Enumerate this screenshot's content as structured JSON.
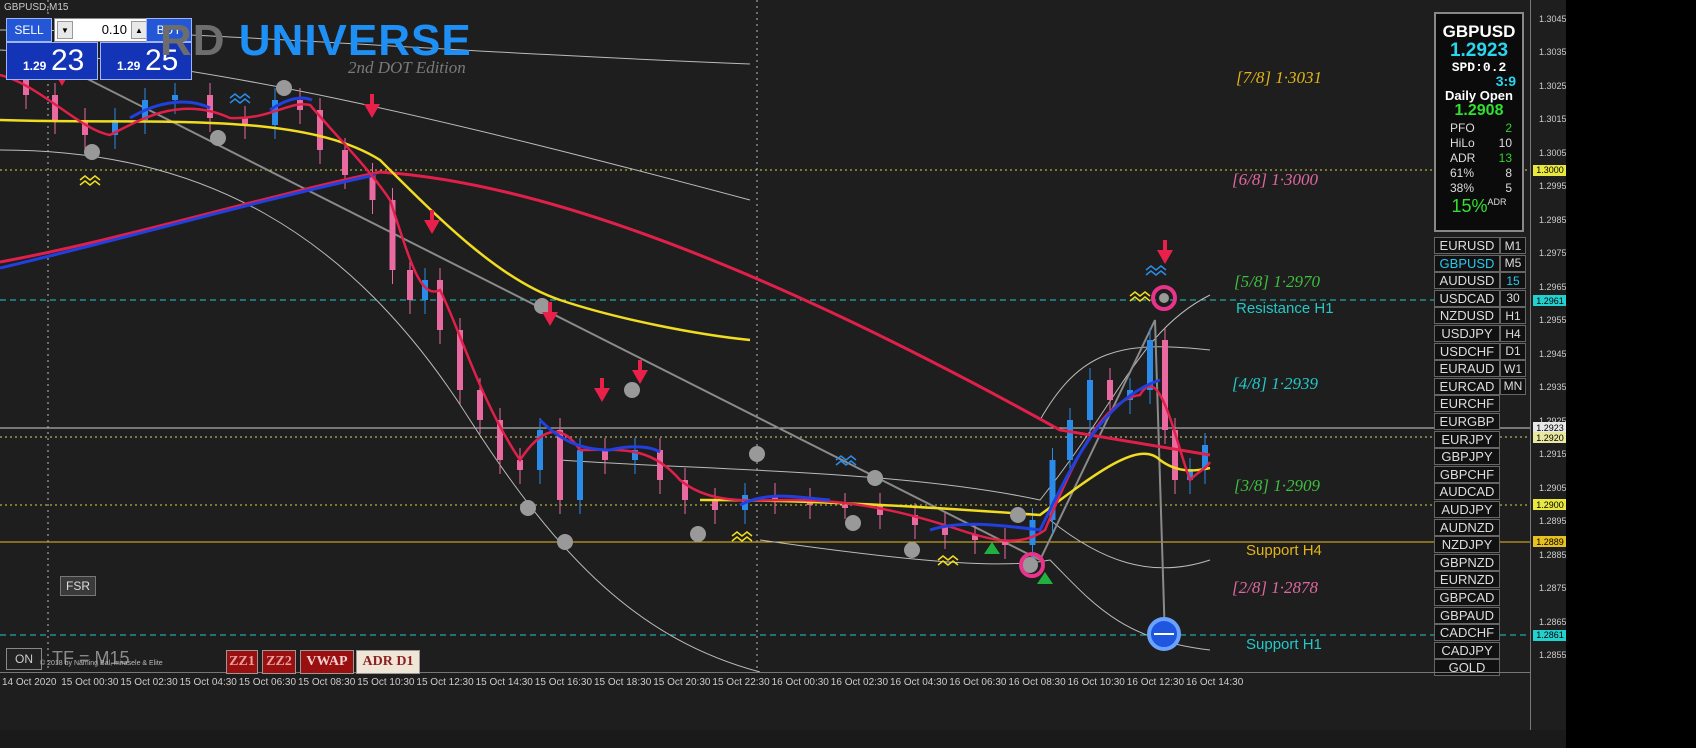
{
  "window": {
    "title": "GBPUSD,M15"
  },
  "trade_panel": {
    "sell_label": "SELL",
    "buy_label": "BUY",
    "lot": "0.10",
    "sell_small": "1.29",
    "sell_big": "23",
    "buy_small": "1.29",
    "buy_big": "25"
  },
  "logo": {
    "part1": "RD ",
    "part2": "UNIVERSE",
    "subtitle": "2nd DOT Edition"
  },
  "levels": [
    {
      "text": "[7/8]  1·3031",
      "color": "#e3b416"
    },
    {
      "text": "[6/8]  1·3000",
      "color": "#e0679f"
    },
    {
      "text": "[5/8]  1·2970",
      "color": "#3fbe3f"
    },
    {
      "text": "[4/8]  1·2939",
      "color": "#23c8c8"
    },
    {
      "text": "[3/8]  1·2909",
      "color": "#3fbe3f"
    },
    {
      "text": "[2/8]  1·2878",
      "color": "#e0679f"
    }
  ],
  "labels": {
    "resistance_h1": "Resistance H1",
    "support_h4": "Support H4",
    "support_h1": "Support H1"
  },
  "info": {
    "symbol": "GBPUSD",
    "price": "1.2923",
    "spread": "SPD:0.2",
    "ratio": "3:9",
    "daily_open_label": "Daily Open",
    "daily_open": "1.2908",
    "rows": [
      {
        "k": "PFO",
        "v": "2",
        "c": "#2fd42f"
      },
      {
        "k": "HiLo",
        "v": "10",
        "c": "#ddd"
      },
      {
        "k": "ADR",
        "v": "13",
        "c": "#2fd42f"
      },
      {
        "k": "61%",
        "v": "8",
        "c": "#ddd"
      },
      {
        "k": "38%",
        "v": "5",
        "c": "#ddd"
      }
    ],
    "pct": "15%",
    "pct_suffix": "ADR"
  },
  "symbols": [
    "EURUSD",
    "GBPUSD",
    "AUDUSD",
    "USDCAD",
    "NZDUSD",
    "USDJPY",
    "USDCHF",
    "EURAUD",
    "EURCAD",
    "EURCHF",
    "EURGBP",
    "EURJPY",
    "GBPJPY",
    "GBPCHF",
    "AUDCAD",
    "AUDJPY",
    "AUDNZD",
    "NZDJPY",
    "GBPNZD",
    "EURNZD",
    "GBPCAD",
    "GBPAUD",
    "CADCHF",
    "CADJPY",
    "GOLD"
  ],
  "timeframes": [
    "M1",
    "M5",
    "15",
    "30",
    "H1",
    "H4",
    "D1",
    "W1",
    "MN"
  ],
  "price_axis": {
    "ticks": [
      "1.3045",
      "1.3035",
      "1.3025",
      "1.3015",
      "1.3005",
      "1.2995",
      "1.2985",
      "1.2975",
      "1.2965",
      "1.2955",
      "1.2945",
      "1.2935",
      "1.2925",
      "1.2915",
      "1.2905",
      "1.2895",
      "1.2885",
      "1.2875",
      "1.2865",
      "1.2855"
    ],
    "tags": [
      {
        "t": "1.3000",
        "c": "#e8e840"
      },
      {
        "t": "1.2961",
        "c": "#23d0d0"
      },
      {
        "t": "1.2923",
        "c": "#e8e8e8"
      },
      {
        "t": "1.2920",
        "c": "#e8e8a0"
      },
      {
        "t": "1.2900",
        "c": "#e8e840"
      },
      {
        "t": "1.2889",
        "c": "#e8c020"
      },
      {
        "t": "1.2861",
        "c": "#23d0d0"
      }
    ]
  },
  "time_axis": [
    "14 Oct 2020",
    "15 Oct 00:30",
    "15 Oct 02:30",
    "15 Oct 04:30",
    "15 Oct 06:30",
    "15 Oct 08:30",
    "15 Oct 10:30",
    "15 Oct 12:30",
    "15 Oct 14:30",
    "15 Oct 16:30",
    "15 Oct 18:30",
    "15 Oct 20:30",
    "15 Oct 22:30",
    "16 Oct 00:30",
    "16 Oct 02:30",
    "16 Oct 04:30",
    "16 Oct 06:30",
    "16 Oct 08:30",
    "16 Oct 10:30",
    "16 Oct 12:30",
    "16 Oct 14:30"
  ],
  "bottom": {
    "fsr": "FSR",
    "on": "ON",
    "tf": "TF = M15",
    "copyright": "© 2018 by Naming Bal, mirasele & Elite",
    "btns": [
      "ZZ1",
      "ZZ2",
      "VWAP",
      "ADR D1"
    ]
  },
  "colors": {
    "ma_red": "#e0204a",
    "ma_yellow": "#f0dc20",
    "ma_blue": "#2040e0",
    "bull": "#2b8be8",
    "bear": "#e86aa0",
    "cyan_level": "#23c8c8"
  }
}
